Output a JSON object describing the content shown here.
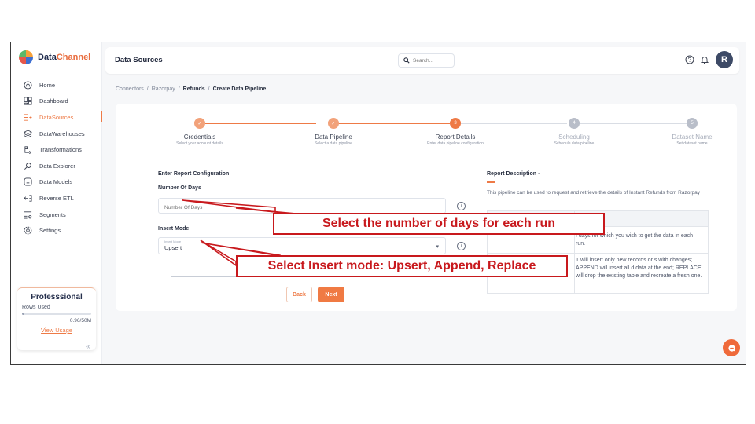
{
  "brand": {
    "name_part1": "Data",
    "name_part2": "Channel"
  },
  "sidebar": {
    "items": [
      {
        "label": "Home",
        "icon": "home-icon"
      },
      {
        "label": "Dashboard",
        "icon": "dashboard-icon"
      },
      {
        "label": "DataSources",
        "icon": "datasources-icon",
        "active": true
      },
      {
        "label": "DataWarehouses",
        "icon": "database-icon"
      },
      {
        "label": "Transformations",
        "icon": "transformations-icon"
      },
      {
        "label": "Data Explorer",
        "icon": "explorer-icon"
      },
      {
        "label": "Data Models",
        "icon": "models-icon"
      },
      {
        "label": "Reverse ETL",
        "icon": "reverse-etl-icon"
      },
      {
        "label": "Segments",
        "icon": "segments-icon"
      },
      {
        "label": "Settings",
        "icon": "settings-icon"
      }
    ],
    "plan": {
      "title": "Professsional",
      "rows_label": "Rows Used",
      "count": "0.96/50M",
      "usage_fraction": 0.02,
      "link": "View Usage"
    },
    "collapse": "«"
  },
  "topbar": {
    "title": "Data Sources",
    "search_placeholder": "Search...",
    "avatar_initial": "R"
  },
  "breadcrumb": {
    "items": [
      "Connectors",
      "Razorpay",
      "Refunds",
      "Create Data Pipeline"
    ],
    "separator": "/"
  },
  "stepper": {
    "steps": [
      {
        "label": "Credentials",
        "sub": "Select your account details",
        "status": "done",
        "marker": "✓"
      },
      {
        "label": "Data Pipeline",
        "sub": "Select a data pipeline",
        "status": "done",
        "marker": "✓"
      },
      {
        "label": "Report Details",
        "sub": "Enter data pipeline configuration",
        "status": "current",
        "marker": "3"
      },
      {
        "label": "Scheduling",
        "sub": "Schedule data pipeline",
        "status": "todo",
        "marker": "4"
      },
      {
        "label": "Dataset Name",
        "sub": "Set dataset name",
        "status": "todo",
        "marker": "5"
      }
    ]
  },
  "form": {
    "section_title": "Enter Report Configuration",
    "days_label": "Number Of Days",
    "days_placeholder": "Number Of Days",
    "insert_label": "Insert Mode",
    "insert_tiny_label": "Insert Mode",
    "insert_value": "Upsert",
    "info_glyph": "i",
    "caret_glyph": "▾",
    "back_label": "Back",
    "next_label": "Next"
  },
  "description": {
    "title": "Report Description -",
    "text": "This pipeline can be used to request and retrieve the details of Instant Refunds from Razorpay",
    "rows": [
      "f days for which you wish to get the data in each run.",
      "T will insert only new records or s with changes; APPEND will insert all d data at the end; REPLACE will drop the existing table and recreate a fresh one."
    ]
  },
  "callouts": {
    "days": "Select the number of days for each run",
    "insert": "Select Insert mode: Upsert, Append, Replace"
  },
  "colors": {
    "accent": "#ee7a46",
    "callout": "#c8191d"
  }
}
